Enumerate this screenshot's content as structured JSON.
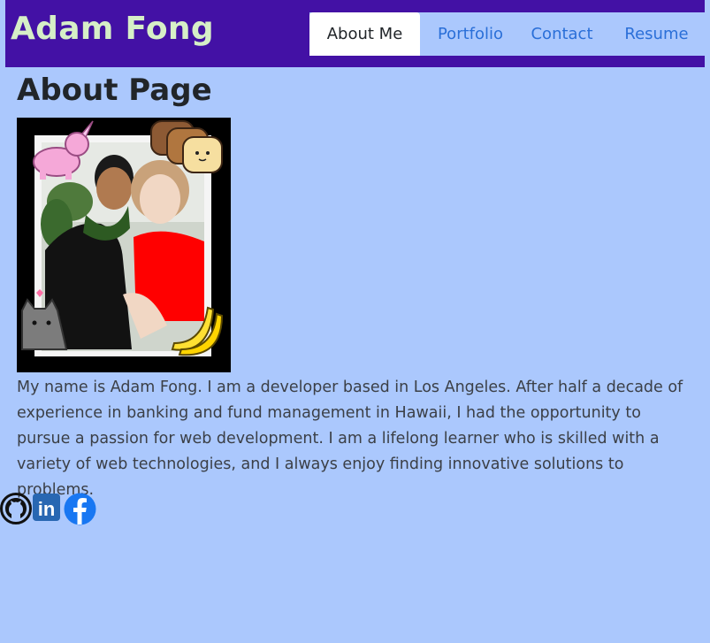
{
  "header": {
    "brand": "Adam Fong",
    "nav": [
      "About Me",
      "Portfolio",
      "Contact",
      "Resume"
    ],
    "active_tab": "About Me"
  },
  "main": {
    "title": "About Page",
    "photo_alt": "Adam Fong with sticker decorations",
    "bio": "My name is Adam Fong. I am a developer based in Los Angeles. After half a decade of experience in banking and fund management in Hawaii, I had the opportunity to pursue a passion for web development. I am a lifelong learner who is skilled with a variety of web technologies, and I always enjoy finding innovative solutions to problems."
  },
  "social": {
    "icons": [
      "github-icon",
      "linkedin-icon",
      "facebook-icon"
    ],
    "linkedin_text": "in"
  },
  "colors": {
    "page_bg": "#abc8fd",
    "header_bg": "#4311a5",
    "brand_text": "#d6efc7",
    "nav_link": "#2a6fd8",
    "linkedin": "#2867b2",
    "facebook": "#1877f2"
  }
}
